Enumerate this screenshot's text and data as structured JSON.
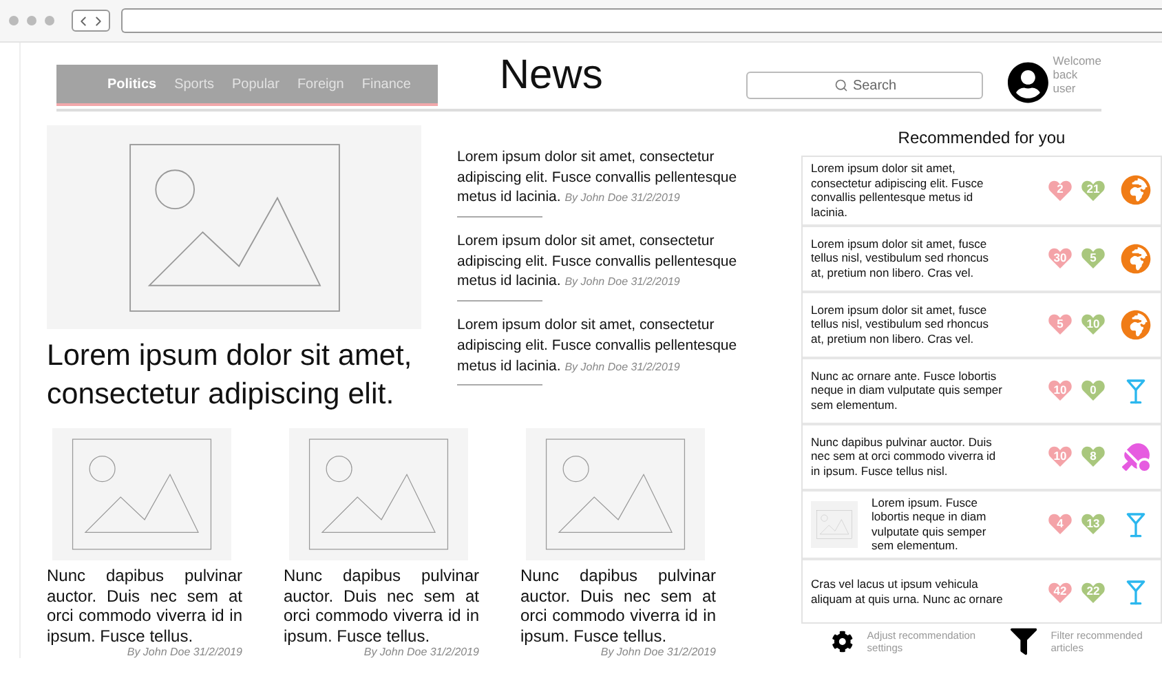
{
  "nav": [
    {
      "label": "Politics",
      "selected": true
    },
    {
      "label": "Sports",
      "selected": false
    },
    {
      "label": "Popular",
      "selected": false
    },
    {
      "label": "Foreign",
      "selected": false
    },
    {
      "label": "Finance",
      "selected": false
    }
  ],
  "title": "News",
  "search": {
    "placeholder": "Search"
  },
  "user": {
    "greeting": "Welcome back user"
  },
  "hero": {
    "headline": "Lorem ipsum dolor sit amet, consectetur adipiscing elit."
  },
  "headlines": [
    {
      "text": "Lorem ipsum dolor sit amet, consectetur adipiscing elit. Fusce convallis pellentesque metus id lacinia.",
      "byline": "By John Doe 31/2/2019"
    },
    {
      "text": "Lorem ipsum dolor sit amet, consectetur adipiscing elit. Fusce convallis pellentesque metus id lacinia.",
      "byline": "By John Doe 31/2/2019"
    },
    {
      "text": "Lorem ipsum dolor sit amet, consectetur adipiscing elit. Fusce convallis pellentesque metus id lacinia.",
      "byline": "By John Doe 31/2/2019"
    }
  ],
  "cards": [
    {
      "text": "Nunc dapibus pulvinar auctor. Duis nec sem at orci commodo viverra id in ipsum. Fusce tellus.",
      "byline": "By John Doe 31/2/2019"
    },
    {
      "text": "Nunc dapibus pulvinar auctor. Duis nec sem at orci commodo viverra id in ipsum. Fusce tellus.",
      "byline": "By John Doe 31/2/2019"
    },
    {
      "text": "Nunc dapibus pulvinar auctor. Duis nec sem at orci commodo viverra id in ipsum. Fusce tellus.",
      "byline": "By John Doe 31/2/2019"
    }
  ],
  "recommended": {
    "title": "Recommended for you",
    "items": [
      {
        "text": "Lorem ipsum dolor sit amet, consectetur adipiscing elit. Fusce convallis pellentesque metus id lacinia.",
        "thumbnail": false,
        "kind": "globe",
        "votes": [
          {
            "text": "2",
            "color": "#f4a3a8"
          },
          {
            "text": "21",
            "color": "#a9c77d"
          }
        ]
      },
      {
        "text": "Lorem ipsum dolor sit amet,  fusce tellus nisl, vestibulum sed rhoncus at, pretium non libero. Cras vel.",
        "thumbnail": false,
        "kind": "globe",
        "votes": [
          {
            "text": "30",
            "color": "#f4a3a8"
          },
          {
            "text": "5",
            "color": "#a9c77d"
          }
        ]
      },
      {
        "text": "Lorem ipsum dolor sit amet,  fusce tellus nisl, vestibulum sed rhoncus at, pretium non libero. Cras vel.",
        "thumbnail": false,
        "kind": "globe",
        "votes": [
          {
            "text": "5",
            "color": "#f4a3a8"
          },
          {
            "text": "10",
            "color": "#a9c77d"
          }
        ]
      },
      {
        "text": "Nunc ac ornare ante. Fusce lobortis neque in diam vulputate quis semper sem elementum.",
        "thumbnail": false,
        "kind": "cocktail",
        "votes": [
          {
            "text": "10",
            "color": "#f4a3a8"
          },
          {
            "text": "0",
            "color": "#a9c77d"
          }
        ]
      },
      {
        "text": "Nunc dapibus pulvinar auctor. Duis nec sem at orci commodo viverra id in ipsum. Fusce tellus nisl.",
        "thumbnail": false,
        "kind": "table-tennis",
        "votes": [
          {
            "text": "10",
            "color": "#f4a3a8"
          },
          {
            "text": "8",
            "color": "#a9c77d"
          }
        ]
      },
      {
        "text": "Lorem ipsum. Fusce lobortis neque in diam vulputate quis semper sem elementum.",
        "thumbnail": true,
        "kind": "cocktail",
        "votes": [
          {
            "text": "4",
            "color": "#f4a3a8"
          },
          {
            "text": "13",
            "color": "#a9c77d"
          }
        ]
      },
      {
        "text": "Cras vel lacus ut ipsum vehicula aliquam at quis urna. Nunc ac ornare",
        "thumbnail": false,
        "kind": "cocktail",
        "votes": [
          {
            "text": "42",
            "color": "#f4a3a8"
          },
          {
            "text": "22",
            "color": "#a9c77d"
          }
        ]
      }
    ]
  },
  "actions": [
    {
      "kind": "settings",
      "label": "Adjust recommendation settings"
    },
    {
      "kind": "filter",
      "label": "Filter recommended articles"
    }
  ]
}
